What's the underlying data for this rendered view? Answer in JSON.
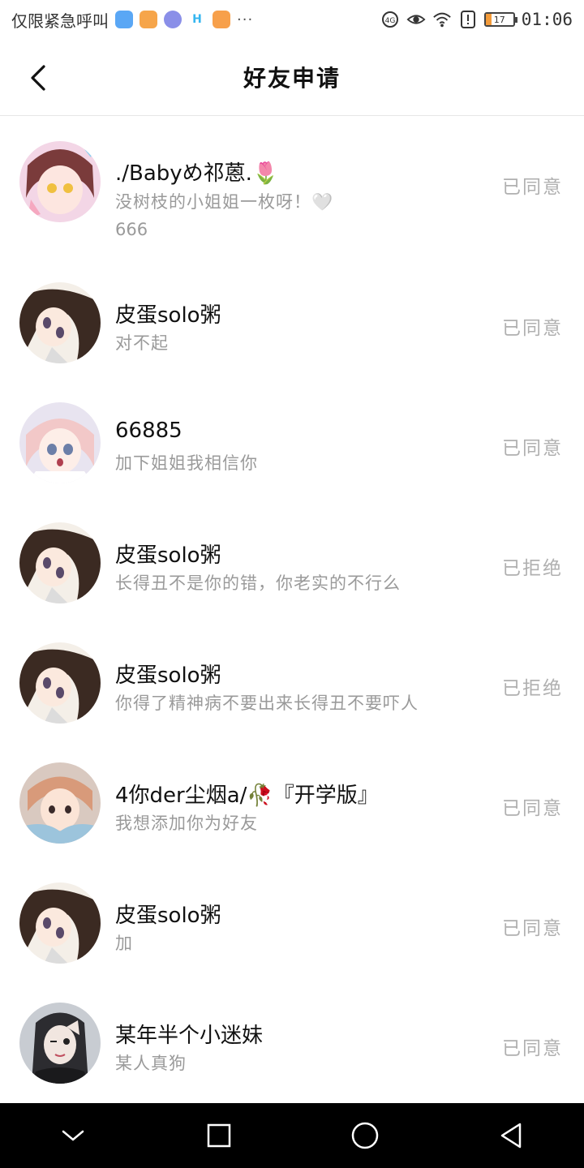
{
  "status_bar": {
    "carrier": "仅限紧急呼叫",
    "dots": "···",
    "battery": "17",
    "time": "01:06",
    "colors": {
      "app1": "#5aa7f5",
      "app2": "#f6a54a",
      "app3": "#8a8fe8",
      "app4": "#35b6f0",
      "app5": "#f7a04b"
    }
  },
  "header": {
    "title": "好友申请",
    "back_icon": "chevron-left-icon"
  },
  "items": [
    {
      "name": "./Babyめ祁蒽.🌷",
      "message": "没树枝的小姐姐一枚呀！🤍",
      "message2": "666",
      "status": "已同意"
    },
    {
      "name": "皮蛋solo粥",
      "message": "对不起",
      "message2": "",
      "status": "已同意"
    },
    {
      "name": "66885",
      "message": "加下姐姐我相信你",
      "message2": "",
      "status": "已同意"
    },
    {
      "name": "皮蛋solo粥",
      "message": "长得丑不是你的错，你老实的不行么",
      "message2": "",
      "status": "已拒绝"
    },
    {
      "name": "皮蛋solo粥",
      "message": "你得了精神病不要出来长得丑不要吓人",
      "message2": "",
      "status": "已拒绝"
    },
    {
      "name": "4你der尘烟a/🥀『开学版』",
      "message": "我想添加你为好友",
      "message2": "",
      "status": "已同意"
    },
    {
      "name": "皮蛋solo粥",
      "message": "加",
      "message2": "",
      "status": "已同意"
    },
    {
      "name": "某年半个小迷妹",
      "message": "某人真狗",
      "message2": "",
      "status": "已同意"
    }
  ],
  "nav": {
    "back_icon": "nav-back-triangle-icon",
    "home_icon": "nav-home-circle-icon",
    "recent_icon": "nav-recent-square-icon",
    "down_icon": "nav-collapse-chevron-icon"
  }
}
